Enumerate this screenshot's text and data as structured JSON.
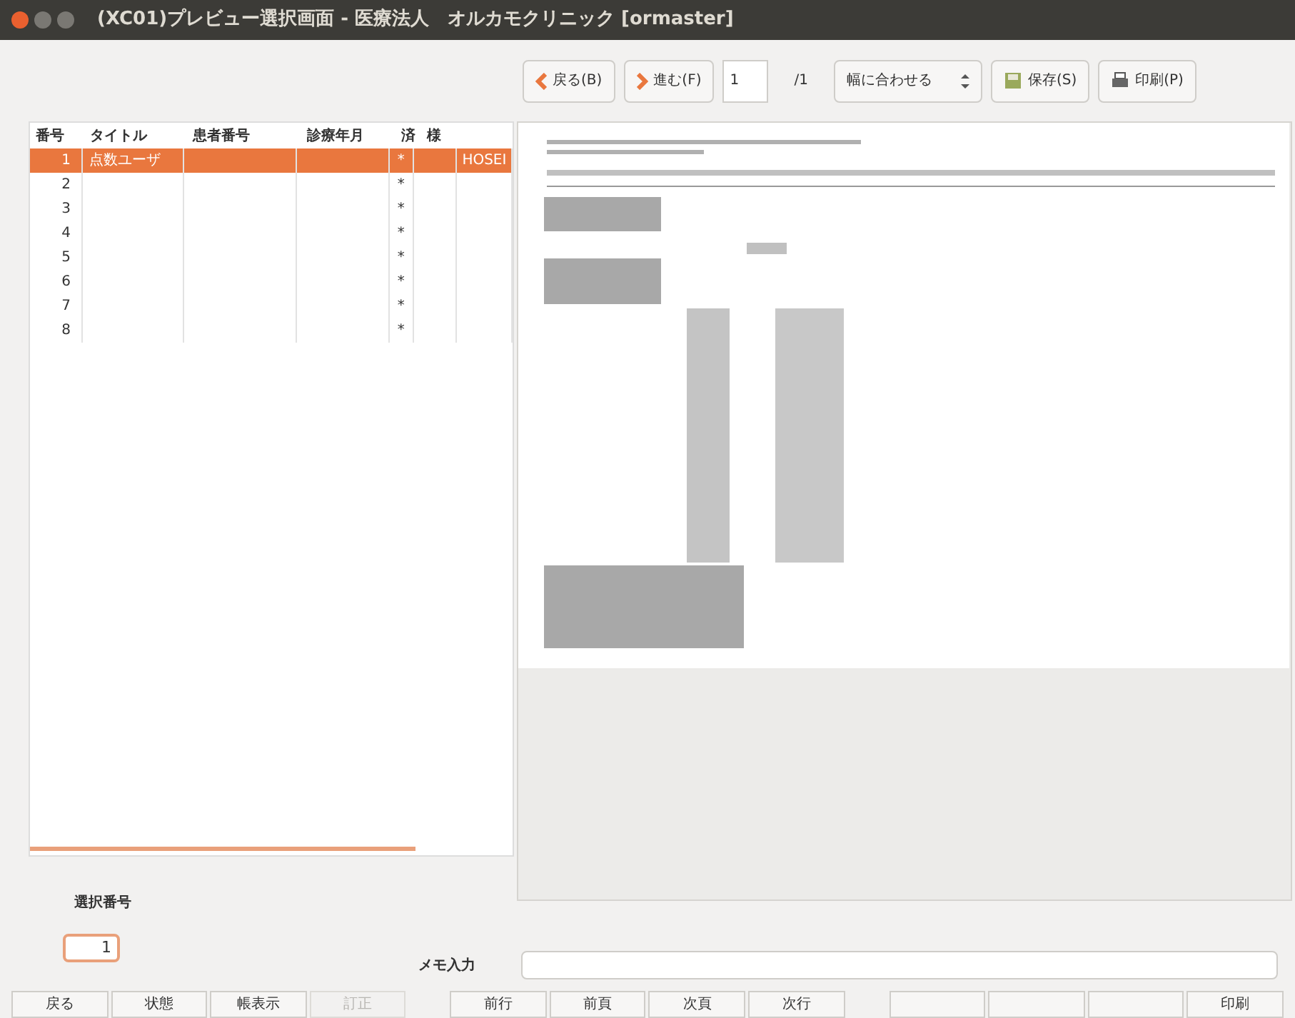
{
  "window": {
    "title": "(XC01)プレビュー選択画面 - 医療法人　オルカモクリニック [ormaster]"
  },
  "toolbar": {
    "back": "戻る(B)",
    "forward": "進む(F)",
    "page": "1",
    "page_total": "/1",
    "zoom": "幅に合わせる",
    "save": "保存(S)",
    "print": "印刷(P)"
  },
  "table": {
    "columns": [
      "番号",
      "タイトル",
      "患者番号",
      "診療年月",
      "済",
      "様"
    ],
    "rows": [
      {
        "cells": [
          "1",
          "点数ユーザ",
          "",
          "",
          "*",
          "",
          "HOSEI"
        ],
        "selected": true
      },
      {
        "cells": [
          "2",
          "",
          "",
          "",
          "*",
          "",
          ""
        ],
        "selected": false
      },
      {
        "cells": [
          "3",
          "",
          "",
          "",
          "*",
          "",
          ""
        ],
        "selected": false
      },
      {
        "cells": [
          "4",
          "",
          "",
          "",
          "*",
          "",
          ""
        ],
        "selected": false
      },
      {
        "cells": [
          "5",
          "",
          "",
          "",
          "*",
          "",
          ""
        ],
        "selected": false
      },
      {
        "cells": [
          "6",
          "",
          "",
          "",
          "*",
          "",
          ""
        ],
        "selected": false
      },
      {
        "cells": [
          "7",
          "",
          "",
          "",
          "*",
          "",
          ""
        ],
        "selected": false
      },
      {
        "cells": [
          "8",
          "",
          "",
          "",
          "*",
          "",
          ""
        ],
        "selected": false
      }
    ]
  },
  "selection": {
    "label": "選択番号",
    "value": "1"
  },
  "memo": {
    "label": "メモ入力"
  },
  "buttons": [
    {
      "label": "戻る",
      "disabled": false
    },
    {
      "label": "状態",
      "disabled": false
    },
    {
      "label": "帳表示",
      "disabled": false
    },
    {
      "label": "訂正",
      "disabled": true
    },
    {
      "label": "前行",
      "disabled": false
    },
    {
      "label": "前頁",
      "disabled": false
    },
    {
      "label": "次頁",
      "disabled": false
    },
    {
      "label": "次行",
      "disabled": false
    },
    {
      "disabled": false
    },
    {
      "disabled": false
    },
    {
      "disabled": false
    },
    {
      "label": "印刷",
      "disabled": false
    }
  ]
}
